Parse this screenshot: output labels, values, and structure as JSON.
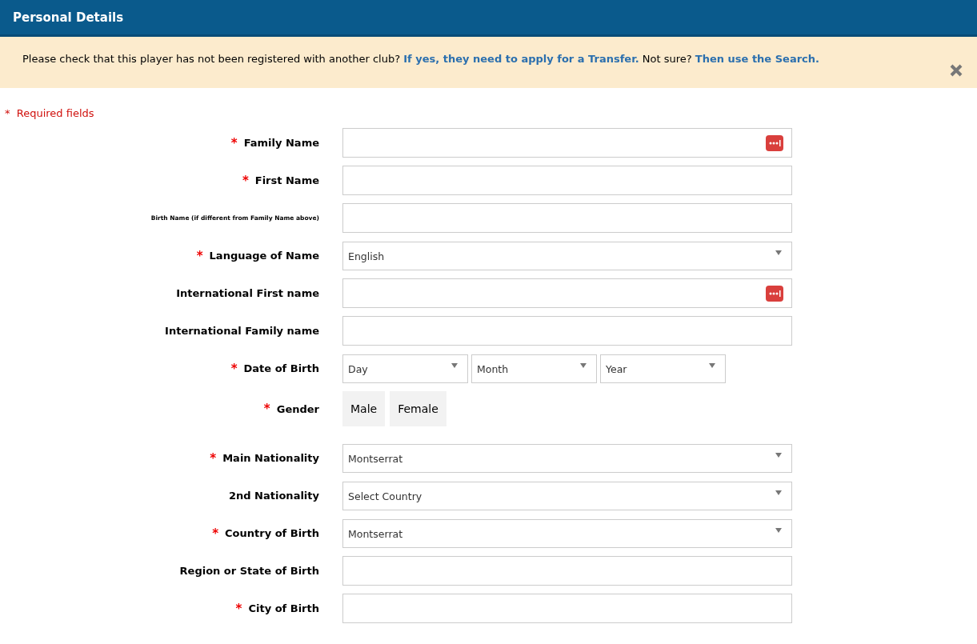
{
  "header": {
    "title": "Personal Details"
  },
  "notice": {
    "parts": [
      {
        "kind": "text",
        "text": "Please check that this player has not been registered with another club? "
      },
      {
        "kind": "link",
        "text": "If yes, they need to apply for a Transfer."
      },
      {
        "kind": "text",
        "text": " Not sure? "
      },
      {
        "kind": "link",
        "text": "Then use the Search."
      }
    ]
  },
  "required_note": {
    "marker": "*",
    "text": "Required fields"
  },
  "fields": [
    {
      "kind": "text",
      "marker": "*",
      "label": "Family Name",
      "autofill_icon": true
    },
    {
      "kind": "text",
      "marker": "*",
      "label": "First Name",
      "autofill_icon": false
    },
    {
      "kind": "text",
      "label": "Birth Name (if different from Family Name above)",
      "small_label": true,
      "autofill_icon": false
    },
    {
      "kind": "select",
      "marker": "*",
      "label": "Language of Name",
      "value": "English"
    },
    {
      "kind": "text",
      "label": "International First name",
      "autofill_icon": true
    },
    {
      "kind": "text",
      "label": "International Family name",
      "autofill_icon": false
    },
    {
      "kind": "date",
      "marker": "*",
      "label": "Date of Birth",
      "parts": [
        "Day",
        "Month",
        "Year"
      ]
    },
    {
      "kind": "toggle",
      "marker": "*",
      "label": "Gender",
      "options": [
        {
          "label": "Male",
          "selected": false
        },
        {
          "label": "Female",
          "selected": false
        }
      ]
    },
    {
      "kind": "select",
      "marker": "*",
      "label": "Main Nationality",
      "value": "Montserrat"
    },
    {
      "kind": "select",
      "label": "2nd Nationality",
      "value": "Select Country"
    },
    {
      "kind": "select",
      "marker": "*",
      "label": "Country of Birth",
      "value": "Montserrat"
    },
    {
      "kind": "text",
      "label": "Region or State of Birth",
      "autofill_icon": false
    },
    {
      "kind": "text",
      "marker": "*",
      "label": "City of Birth",
      "autofill_icon": false
    }
  ]
}
